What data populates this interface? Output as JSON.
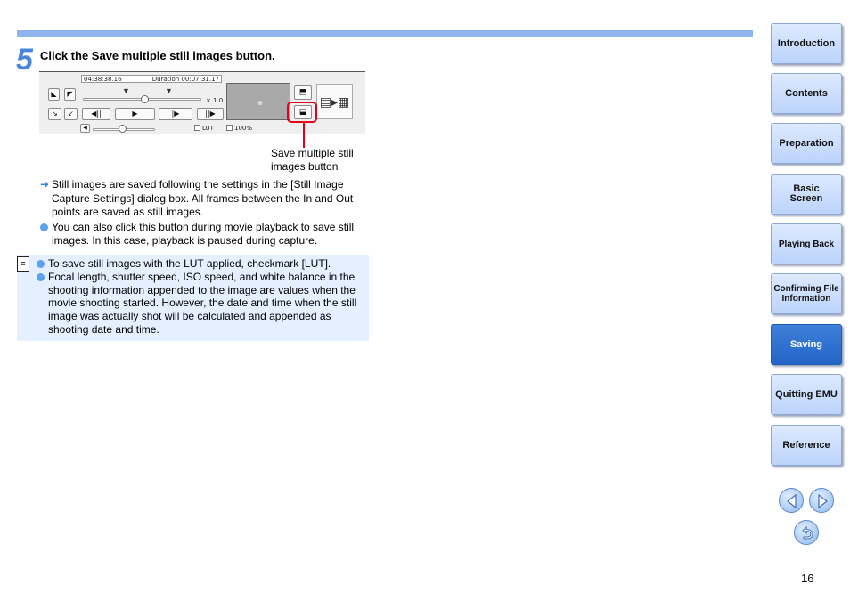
{
  "step": {
    "number": "5",
    "title": "Click the Save multiple still images button."
  },
  "player": {
    "timecode": "04:38:38.16",
    "duration": "Duration 00:07:31.17",
    "speed": "× 1.0",
    "lut_label": "LUT",
    "zoom_label": "100%"
  },
  "callout": {
    "text": "Save multiple still images button"
  },
  "bullets": [
    {
      "type": "arrow",
      "text": "Still images are saved following the settings in the [Still Image Capture Settings] dialog box. All frames between the In and Out points are saved as still images."
    },
    {
      "type": "dot",
      "text": "You can also click this button during movie playback to save still images. In this case, playback is paused during capture."
    }
  ],
  "note": {
    "items": [
      "To save still images with the LUT applied, checkmark [LUT].",
      "Focal length, shutter speed, ISO speed, and white balance in the shooting information appended to the image are values when the movie shooting started. However, the date and time when the still image was actually shot will be calculated and appended as shooting date and time."
    ]
  },
  "nav": {
    "items": [
      {
        "label": "Introduction"
      },
      {
        "label": "Contents"
      },
      {
        "label": "Preparation"
      },
      {
        "label": "Basic\nScreen"
      },
      {
        "label": "Playing Back"
      },
      {
        "label": "Confirming File\nInformation"
      },
      {
        "label": "Saving"
      },
      {
        "label": "Quitting EMU"
      },
      {
        "label": "Reference"
      }
    ],
    "active": "Saving"
  },
  "page_number": "16",
  "colors": {
    "accent": "#2266c8",
    "highlight": "#e3001b",
    "note_bg": "#e4efff"
  }
}
